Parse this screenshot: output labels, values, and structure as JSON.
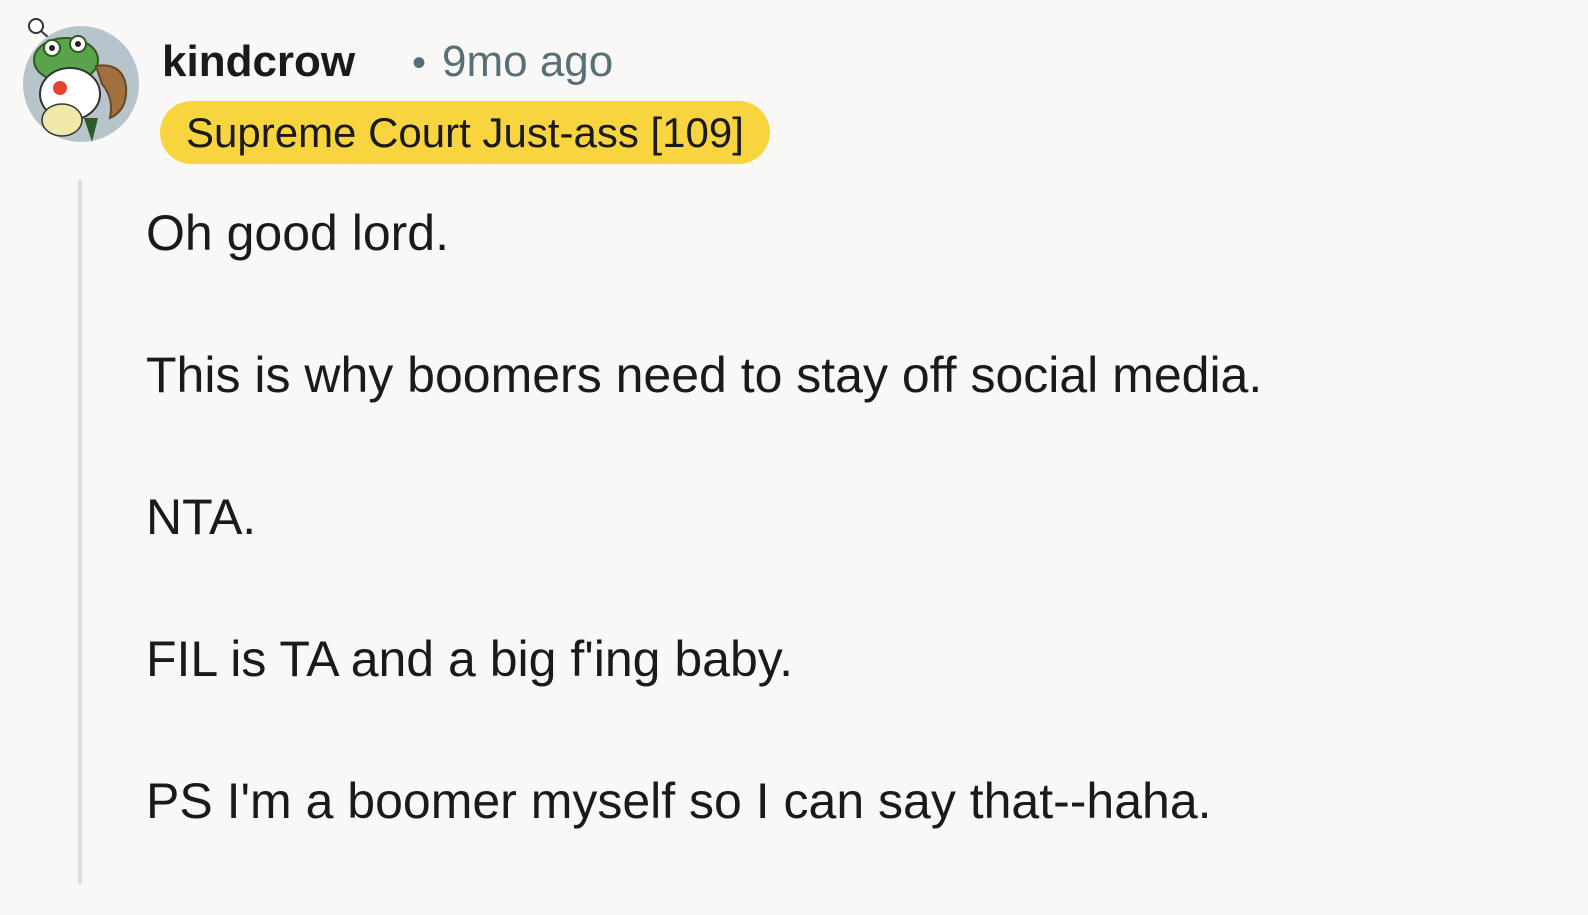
{
  "comment": {
    "author": "kindcrow",
    "separator": "•",
    "timestamp": "9mo ago",
    "flair": "Supreme Court Just-ass [109]",
    "paragraphs": [
      "Oh good lord.",
      "This is why boomers need to stay off social media.",
      "NTA.",
      "FIL is TA and a big f'ing baby.",
      "PS I'm a boomer myself so I can say that--haha."
    ]
  },
  "colors": {
    "background": "#f9f8f6",
    "flair_background": "#f8d43f",
    "meta_text": "#576f76",
    "thread_line": "#e0ddd9",
    "avatar_bg": "#b7c4cc"
  },
  "icons": {
    "avatar": "snoo-avatar-frog-hat"
  }
}
